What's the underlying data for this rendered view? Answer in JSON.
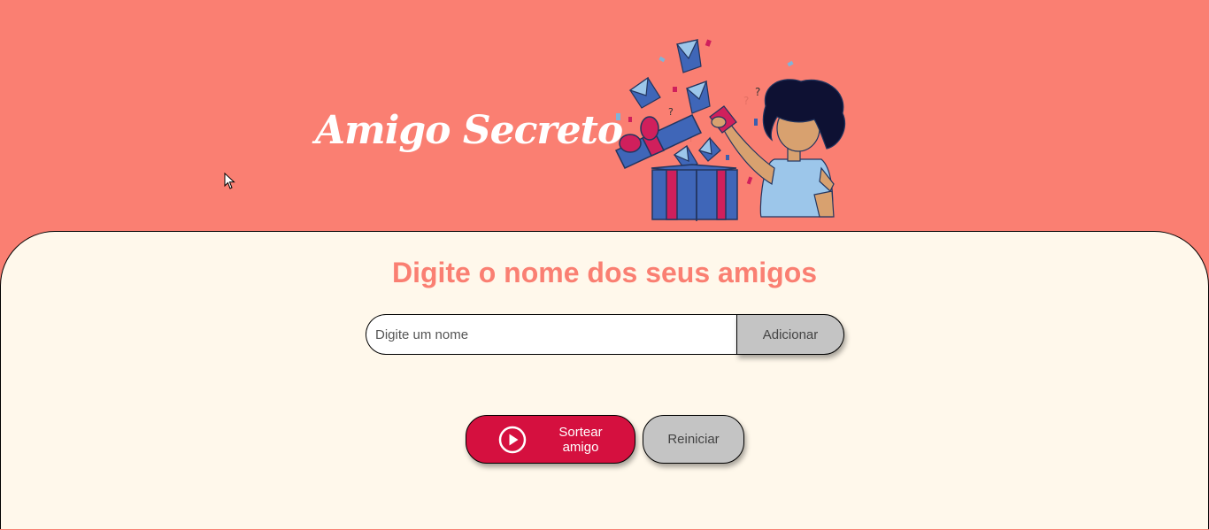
{
  "header": {
    "title": "Amigo Secreto",
    "illustration": "gift-box-person-illustration"
  },
  "main": {
    "heading": "Digite o nome dos seus amigos",
    "name_input": {
      "value": "",
      "placeholder": "Digite um nome"
    },
    "add_label": "Adicionar",
    "draw_label": "Sortear amigo",
    "draw_icon": "play-circle-icon",
    "reset_label": "Reiniciar"
  },
  "colors": {
    "header_bg": "#fa7f72",
    "panel_bg": "#fff8eb",
    "accent_red": "#d5103f",
    "button_gray": "#c4c4c4"
  }
}
